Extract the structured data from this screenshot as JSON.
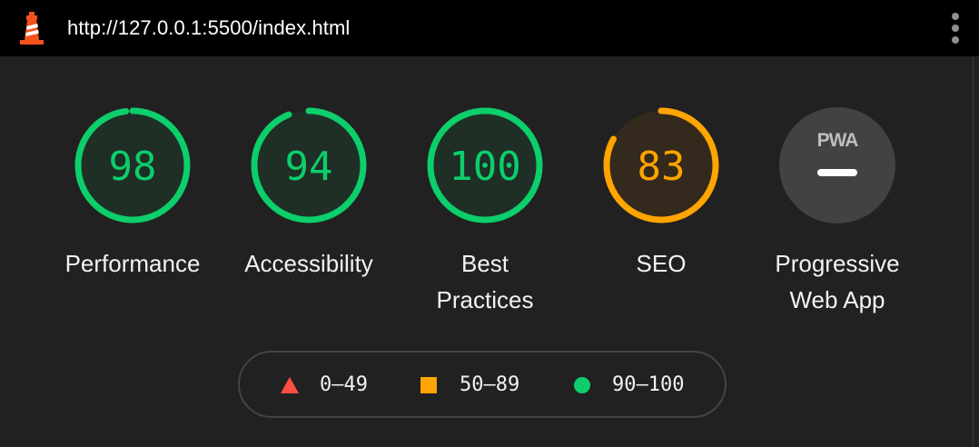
{
  "browser": {
    "url": "http://127.0.0.1:5500/index.html",
    "logo_icon": "lighthouse-icon",
    "menu_icon": "kebab-menu-icon"
  },
  "categories": [
    {
      "id": "performance",
      "score": "98",
      "score_fraction": 0.98,
      "label_lines": [
        "Performance"
      ],
      "status": "pass"
    },
    {
      "id": "accessibility",
      "score": "94",
      "score_fraction": 0.94,
      "label_lines": [
        "Accessibility"
      ],
      "status": "pass"
    },
    {
      "id": "best-practices",
      "score": "100",
      "score_fraction": 1.0,
      "label_lines": [
        "Best",
        "Practices"
      ],
      "status": "pass"
    },
    {
      "id": "seo",
      "score": "83",
      "score_fraction": 0.83,
      "label_lines": [
        "SEO"
      ],
      "status": "average"
    },
    {
      "id": "pwa",
      "badge_text": "PWA",
      "badge_icon": "pwa-badge-icon",
      "label_lines": [
        "Progressive",
        "Web App"
      ],
      "status": "not-applicable"
    }
  ],
  "legend": {
    "items": [
      {
        "icon": "red-triangle-icon",
        "range": "0–49"
      },
      {
        "icon": "orange-square-icon",
        "range": "50–89"
      },
      {
        "icon": "green-circle-icon",
        "range": "90–100"
      }
    ]
  },
  "colors": {
    "pass": "#0cce6b",
    "pass_bg": "#1f2f26",
    "average": "#ffa400",
    "average_bg": "#33291c",
    "fail": "#ff4e42",
    "pwa_bg": "#424242",
    "pwa_text": "#bdbdbd"
  }
}
